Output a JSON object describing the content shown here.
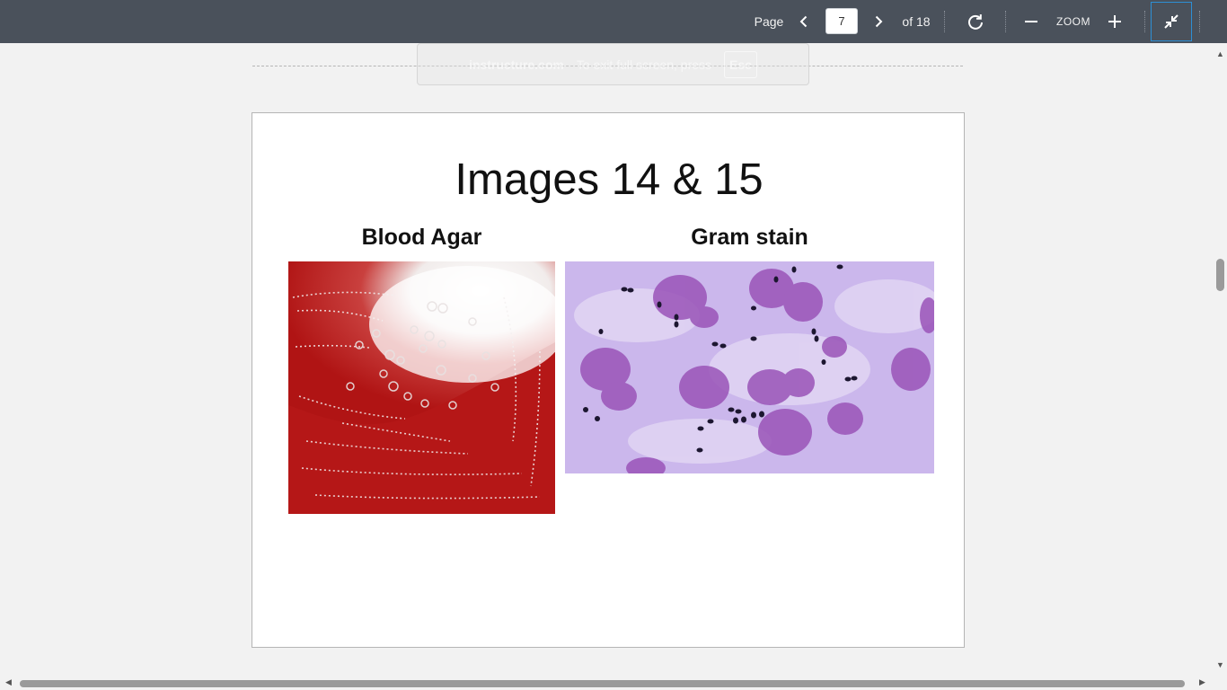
{
  "toolbar": {
    "page_label": "Page",
    "current_page": "7",
    "of_label": "of 18",
    "zoom_label": "ZOOM",
    "icons": {
      "prev": "chevron-left-icon",
      "next": "chevron-right-icon",
      "rotate": "rotate-icon",
      "zoom_out": "minus-icon",
      "zoom_in": "plus-icon",
      "exit_fullscreen": "exit-fullscreen-icon"
    },
    "colors": {
      "background": "#4a515b",
      "focus_border": "#2d8fd5"
    }
  },
  "fullscreen_notice": {
    "domain": "instructure.com",
    "message": "To exit full screen, press",
    "key": "Esc"
  },
  "slide": {
    "title": "Images 14 & 15",
    "left_caption": "Blood Agar",
    "right_caption": "Gram stain"
  }
}
